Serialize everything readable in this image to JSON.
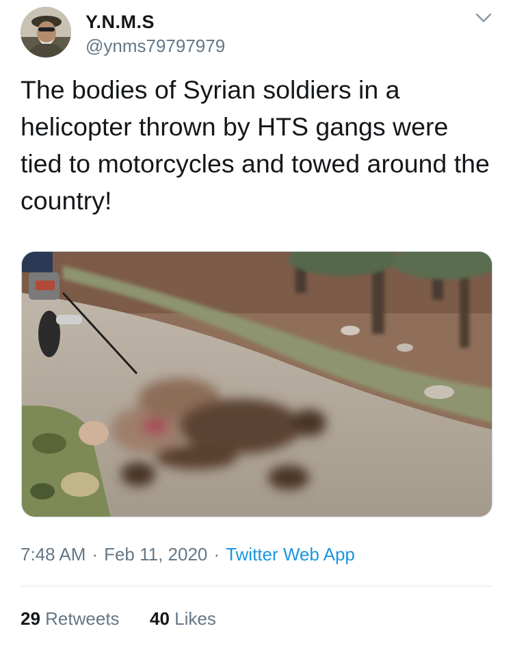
{
  "user": {
    "display_name": "Y.N.M.S",
    "handle": "@ynms79797979"
  },
  "tweet": {
    "text": "The bodies of Syrian soldiers in a helicopter thrown by HTS gangs were tied to motorcycles and towed around the country!",
    "media_description": "photo"
  },
  "meta": {
    "time": "7:48 AM",
    "separator": "·",
    "date": "Feb 11, 2020",
    "source": "Twitter Web App"
  },
  "stats": {
    "retweets_count": "29",
    "retweets_label": "Retweets",
    "likes_count": "40",
    "likes_label": "Likes"
  },
  "icons": {
    "menu": "chevron-down-icon"
  },
  "colors": {
    "text_primary": "#14171a",
    "text_secondary": "#657786",
    "link": "#1b95e0",
    "divider": "#e1e8ed"
  }
}
